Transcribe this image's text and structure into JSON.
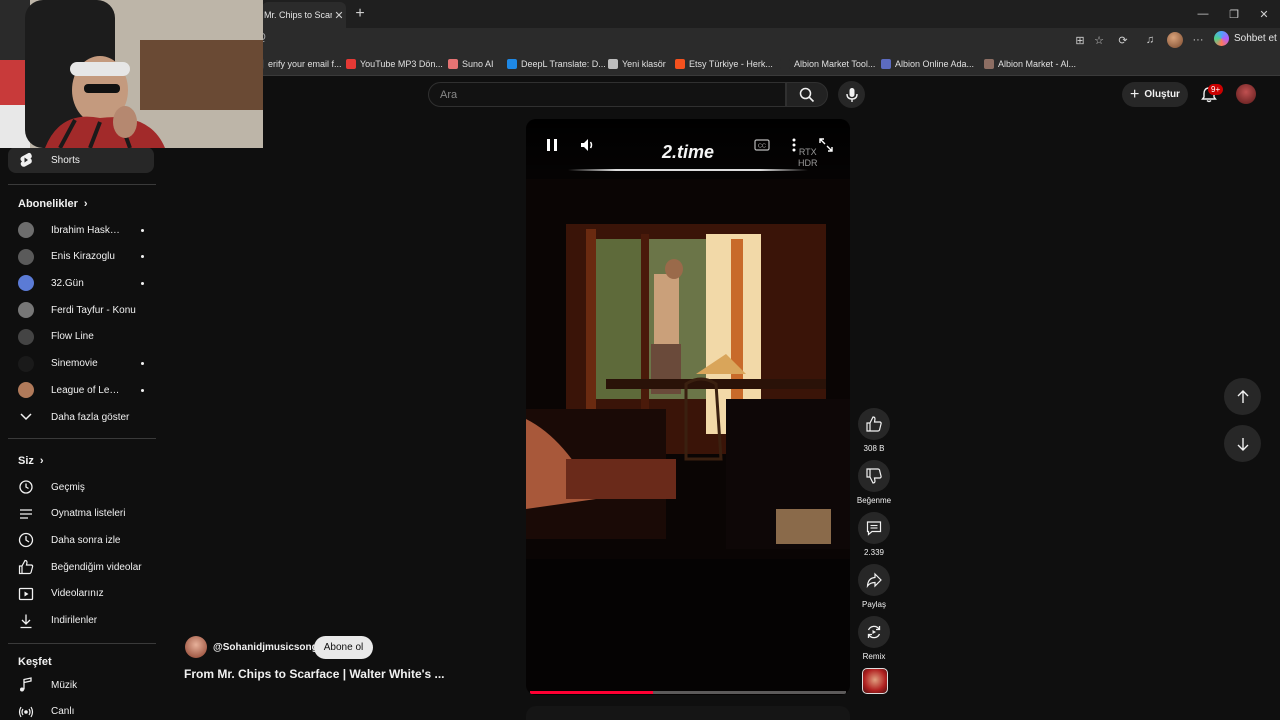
{
  "browser": {
    "active_tab_title": "Mr. Chips to Scarfa",
    "address_text": "Q",
    "copilot_label": "Sohbet et",
    "bookmarks": [
      {
        "label": "erify your email f...",
        "color": "#3a3a3a"
      },
      {
        "label": "YouTube MP3 Dön...",
        "color": "#e53935"
      },
      {
        "label": "Suno AI",
        "color": "#e57373"
      },
      {
        "label": "DeepL Translate: D...",
        "color": "#1e88e5"
      },
      {
        "label": "Yeni klasör",
        "color": "#bdbdbd"
      },
      {
        "label": "Etsy Türkiye - Herk...",
        "color": "#f4511e"
      },
      {
        "label": "Albion Market Tool...",
        "color": "#2b2b2b"
      },
      {
        "label": "Albion Online Ada...",
        "color": "#5c6bc0"
      },
      {
        "label": "Albion Market - Al...",
        "color": "#8d6e63"
      }
    ]
  },
  "youtube": {
    "search_placeholder": "Ara",
    "create_label": "Oluştur",
    "notification_badge": "9+",
    "sidebar": {
      "shorts_label": "Shorts",
      "subscriptions_header": "Abonelikler",
      "subscriptions": [
        {
          "label": "İbrahim Haskolo...",
          "new": true,
          "color": "#6d6d6d"
        },
        {
          "label": "Enis Kirazoglu",
          "new": true,
          "color": "#5a5a5a"
        },
        {
          "label": "32.Gün",
          "new": true,
          "color": "#5b7bd5"
        },
        {
          "label": "Ferdi Tayfur - Konu",
          "new": false,
          "color": "#777"
        },
        {
          "label": "Flow Line",
          "new": false,
          "color": "#444"
        },
        {
          "label": "Sinemovie",
          "new": true,
          "color": "#1a1a1a"
        },
        {
          "label": "League of Legen...",
          "new": true,
          "color": "#b07a5a"
        }
      ],
      "show_more_label": "Daha fazla göster",
      "you_header": "Siz",
      "you_items": [
        {
          "label": "Geçmiş",
          "icon": "history-icon"
        },
        {
          "label": "Oynatma listeleri",
          "icon": "playlist-icon"
        },
        {
          "label": "Daha sonra izle",
          "icon": "clock-icon"
        },
        {
          "label": "Beğendiğim videolar",
          "icon": "thumbs-up-icon"
        },
        {
          "label": "Videolarınız",
          "icon": "video-icon"
        },
        {
          "label": "İndirilenler",
          "icon": "download-icon"
        }
      ],
      "explore_header": "Keşfet",
      "explore_items": [
        {
          "label": "Müzik",
          "icon": "music-icon"
        },
        {
          "label": "Canlı",
          "icon": "live-icon"
        }
      ]
    },
    "short": {
      "overlay_title": "2.time",
      "rtx_label_1": "RTX",
      "rtx_label_2": "HDR",
      "progress": 0.39,
      "channel": "@Sohanidjmusicsongs",
      "subscribe_label": "Abone ol",
      "title": "From Mr. Chips to Scarface | Walter White's ..."
    },
    "actions": {
      "likes": "308 B",
      "dislike_label": "Beğenme",
      "comments": "2.339",
      "share_label": "Paylaş",
      "remix_label": "Remix"
    }
  }
}
